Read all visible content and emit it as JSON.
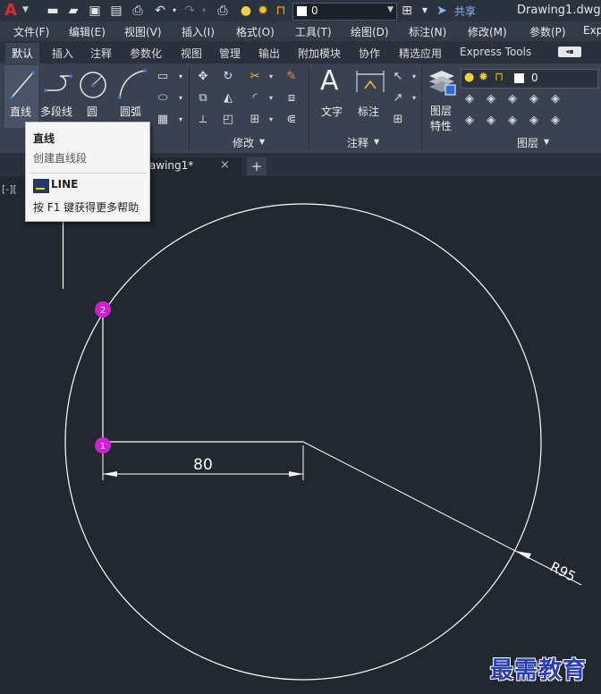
{
  "titlebar": {
    "app_logo": "A",
    "layer_value": "0",
    "share_label": "共享",
    "document_title": "Drawing1.dwg"
  },
  "menus": [
    "文件(F)",
    "编辑(E)",
    "视图(V)",
    "插入(I)",
    "格式(O)",
    "工具(T)",
    "绘图(D)",
    "标注(N)",
    "修改(M)",
    "参数(P)",
    "Exp"
  ],
  "ribbon_tabs": [
    "默认",
    "插入",
    "注释",
    "参数化",
    "视图",
    "管理",
    "输出",
    "附加模块",
    "协作",
    "精选应用",
    "Express Tools"
  ],
  "ribbon": {
    "draw_tools": [
      "直线",
      "多段线",
      "圆",
      "圆弧"
    ],
    "modify_panel_title": "修改",
    "annotation_tools": [
      "文字",
      "标注"
    ],
    "annotation_panel_title": "注释",
    "layer_props_label": [
      "图层",
      "特性"
    ],
    "layer_value": "0",
    "layer_panel_title": "图层"
  },
  "tooltip": {
    "title": "直线",
    "description": "创建直线段",
    "command": "LINE",
    "help": "按 F1 键获得更多帮助"
  },
  "doc_tab": {
    "label": "rawing1*",
    "close": "×",
    "new_tab": "+"
  },
  "viewport_controls": "[-][",
  "drawing": {
    "dimension_value": "80",
    "radius_label": "R95",
    "point_1": "1",
    "point_2": "2"
  },
  "colors": {
    "background": "#212830",
    "point_marker": "#d21fd2",
    "geometry": "#ffffff"
  },
  "watermark": "最需教育"
}
